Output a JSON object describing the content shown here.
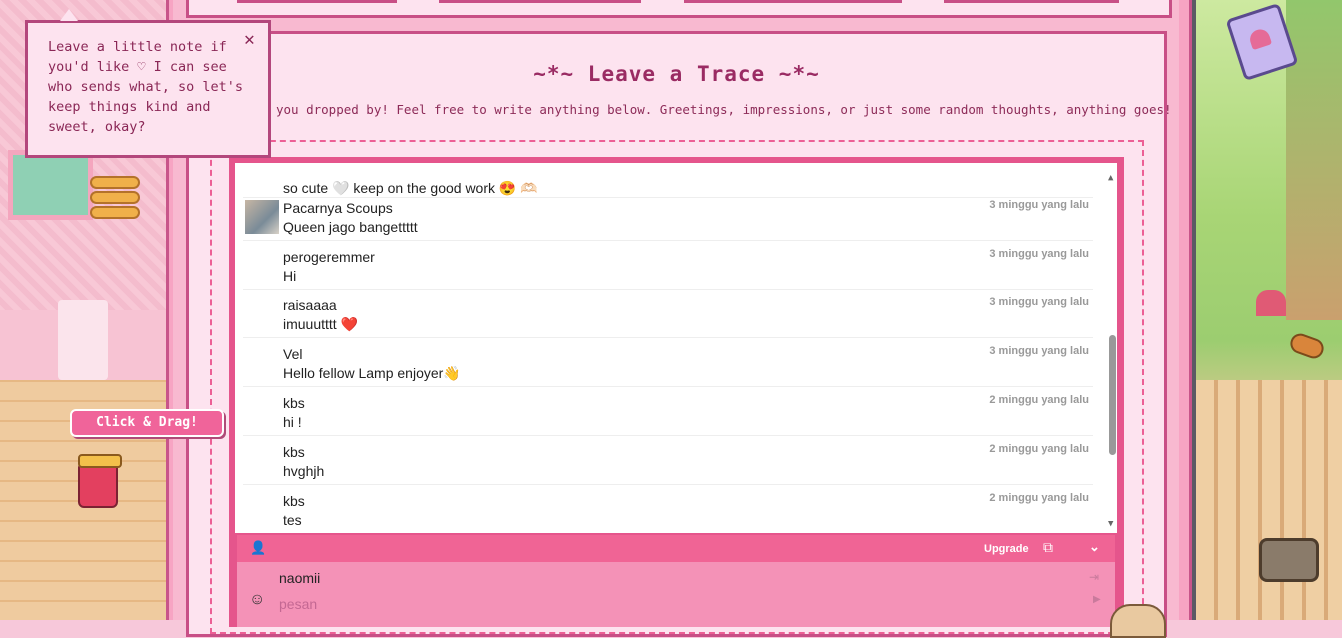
{
  "note": {
    "text": "Leave a little note if you'd like ♡ I can see who sends what, so let's keep things kind and sweet, okay?",
    "close": "✕"
  },
  "drag_label": "Click & Drag!",
  "guestbook": {
    "title": "~*~ Leave a Trace ~*~",
    "subtitle": "you dropped by! Feel free to write anything below. Greetings, impressions, or just some random thoughts, anything goes!"
  },
  "messages": [
    {
      "name": "",
      "text": "so cute 🤍  keep on the good work 😍 🫶🏻",
      "time": ""
    },
    {
      "name": "Pacarnya Scoups",
      "text": "Queen jago bangettttt",
      "time": "3 minggu yang lalu",
      "avatar": true
    },
    {
      "name": "perogeremmer",
      "text": "Hi",
      "time": "3 minggu yang lalu"
    },
    {
      "name": "raisaaaa",
      "text": "imuuutttt ❤️",
      "time": "3 minggu yang lalu"
    },
    {
      "name": "Vel",
      "text": "Hello fellow Lamp enjoyer👋",
      "time": "3 minggu yang lalu"
    },
    {
      "name": "kbs",
      "text": "hi !",
      "time": "2 minggu yang lalu"
    },
    {
      "name": "kbs",
      "text": "hvghjh",
      "time": "2 minggu yang lalu"
    },
    {
      "name": "kbs",
      "text": "tes",
      "time": "2 minggu yang lalu"
    }
  ],
  "chat_bar": {
    "user_icon": "👤",
    "upgrade": "Upgrade",
    "external_icon": "⧉",
    "collapse_icon": "⌄"
  },
  "form": {
    "name_value": "naomii",
    "message_placeholder": "pesan",
    "smile_icon": "☺",
    "login_icon": "⇥",
    "send_icon": "▶"
  },
  "scroll": {
    "up": "▲",
    "down": "▼"
  }
}
